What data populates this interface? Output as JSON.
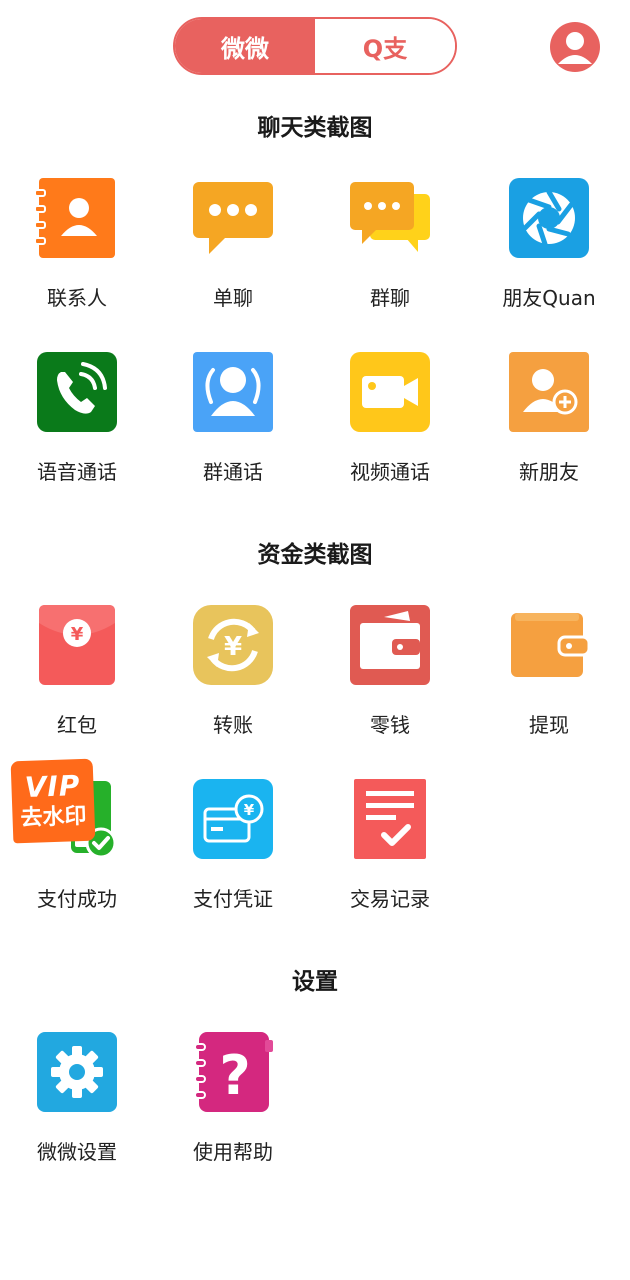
{
  "header": {
    "tab_active": "微微",
    "tab_inactive": "Q支"
  },
  "sections": {
    "chat_title": "聊天类截图",
    "money_title": "资金类截图",
    "settings_title": "设置"
  },
  "chat": {
    "contacts": "联系人",
    "single_chat": "单聊",
    "group_chat": "群聊",
    "moments": "朋友Quan",
    "voice_call": "语音通话",
    "group_call": "群通话",
    "video_call": "视频通话",
    "new_friend": "新朋友"
  },
  "money": {
    "red_packet": "红包",
    "transfer": "转账",
    "change": "零钱",
    "withdraw": "提现",
    "pay_success": "支付成功",
    "pay_receipt": "支付凭证",
    "transactions": "交易记录",
    "yen_symbol": "¥"
  },
  "settings": {
    "weiwei_settings": "微微设置",
    "help": "使用帮助",
    "help_symbol": "?"
  },
  "badge": {
    "line1": "VIP",
    "line2": "去水印"
  },
  "colors": {
    "accent": "#e8625f",
    "orange": "#ff7a1a",
    "amber": "#f5a623",
    "yellow": "#ffc71a",
    "blue": "#1aa0e3",
    "green": "#0a7a1a",
    "sky": "#4aa3f7",
    "red": "#f45a5a",
    "cyan": "#1ab4f0",
    "magenta": "#d4287f"
  }
}
